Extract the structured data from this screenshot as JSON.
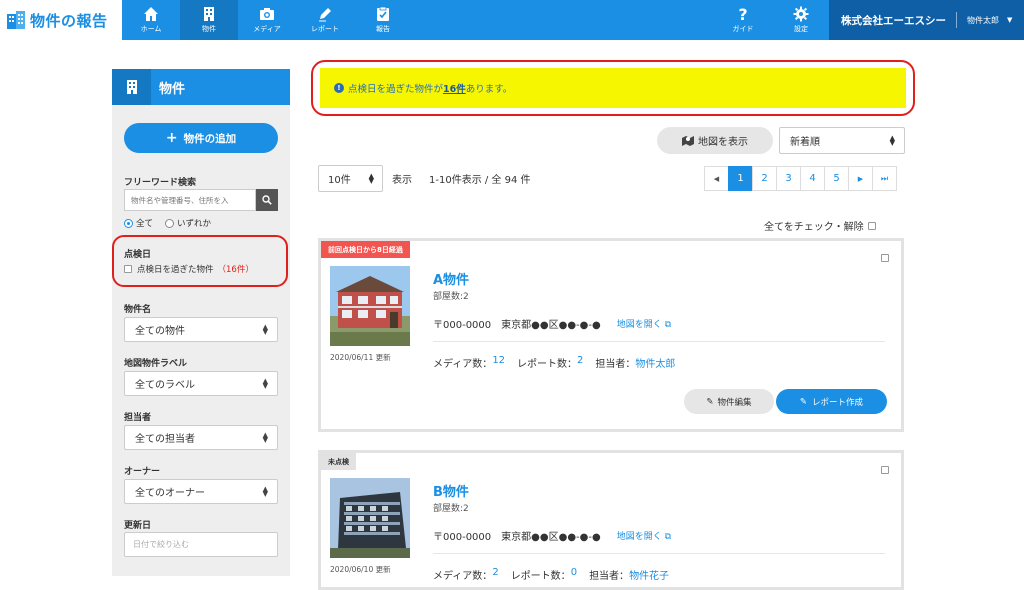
{
  "brand": {
    "name": "物件の報告"
  },
  "nav": [
    {
      "label": "ホーム",
      "icon": "home-icon"
    },
    {
      "label": "物件",
      "icon": "building-icon",
      "active": true
    },
    {
      "label": "メディア",
      "icon": "camera-icon"
    },
    {
      "label": "レポート",
      "icon": "pen-icon"
    },
    {
      "label": "報告",
      "icon": "clipboard-check-icon"
    },
    {
      "label": "ガイド",
      "icon": "question-icon"
    },
    {
      "label": "設定",
      "icon": "gear-icon"
    }
  ],
  "account": {
    "company": "株式会社エーエスシー",
    "user": "物件太郎"
  },
  "sidebar": {
    "title": "物件",
    "add_button": "物件の追加",
    "freeword_label": "フリーワード検索",
    "search_placeholder": "物件名や管理番号、住所を入",
    "radio_all": "全て",
    "radio_any": "いずれか",
    "inspection_label": "点検日",
    "overdue_checkbox": "点検日を過ぎた物件",
    "overdue_count": "（16件）",
    "property_name_label": "物件名",
    "property_name_value": "全ての物件",
    "map_label_label": "地図物件ラベル",
    "map_label_value": "全てのラベル",
    "staff_label": "担当者",
    "staff_value": "全ての担当者",
    "owner_label": "オーナー",
    "owner_value": "全てのオーナー",
    "updated_label": "更新日",
    "updated_placeholder": "日付で絞り込む"
  },
  "alert": {
    "prefix": "点検日を過ぎた物件が",
    "count": "16件",
    "suffix": "あります。"
  },
  "toolbar": {
    "map_button": "地図を表示",
    "sort_value": "新着順",
    "per_page": "10件",
    "show_label": "表示",
    "range_text": "1-10件表示 / 全 94 件",
    "check_all": "全てをチェック・解除"
  },
  "pagination": {
    "prev": "◀",
    "pages": [
      "1",
      "2",
      "3",
      "4",
      "5"
    ],
    "next": "▶",
    "last": "⏭",
    "current": "1"
  },
  "properties": [
    {
      "tag": "前回点検日から8日経過",
      "tag_style": "red",
      "name": "A物件",
      "rooms": "部屋数:2",
      "postal": "〒000-0000",
      "address": "東京都●●区●●-●-●",
      "map_link": "地図を開く",
      "updated": "2020/06/11 更新",
      "media_label": "メディア数：",
      "media_count": "12",
      "report_label": "レポート数：",
      "report_count": "2",
      "staff_label": "担当者：",
      "staff": "物件太郎",
      "edit_button": "物件編集",
      "report_button": "レポート作成"
    },
    {
      "tag": "未点検",
      "tag_style": "gray",
      "name": "B物件",
      "rooms": "部屋数:2",
      "postal": "〒000-0000",
      "address": "東京都●●区●●-●-●",
      "map_link": "地図を開く",
      "updated": "2020/06/10 更新",
      "media_label": "メディア数：",
      "media_count": "2",
      "report_label": "レポート数：",
      "report_count": "0",
      "staff_label": "担当者：",
      "staff": "物件花子"
    }
  ],
  "colors": {
    "primary": "#1a8fe3",
    "alert_bg": "#f6f600",
    "danger": "#e0201c"
  }
}
